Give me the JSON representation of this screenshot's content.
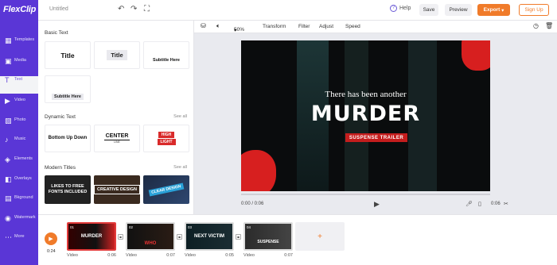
{
  "app": {
    "logo": "FlexClip",
    "doc_title": "Untitled"
  },
  "topbar": {
    "undo_icon": "undo-icon",
    "redo_icon": "redo-icon",
    "fullscreen_icon": "fullscreen-icon",
    "help": "Help",
    "save": "Save",
    "preview": "Preview",
    "export": "Export",
    "signup": "Sign Up"
  },
  "sidebar": {
    "items": [
      {
        "label": "Templates",
        "icon": "templates-icon"
      },
      {
        "label": "Media",
        "icon": "media-icon"
      },
      {
        "label": "Text",
        "icon": "text-icon"
      },
      {
        "label": "Video",
        "icon": "video-icon"
      },
      {
        "label": "Photo",
        "icon": "photo-icon"
      },
      {
        "label": "Music",
        "icon": "music-icon"
      },
      {
        "label": "Elements",
        "icon": "elements-icon"
      },
      {
        "label": "Overlays",
        "icon": "overlays-icon"
      },
      {
        "label": "Bkground",
        "icon": "background-icon"
      },
      {
        "label": "Watermark",
        "icon": "watermark-icon"
      },
      {
        "label": "More",
        "icon": "more-icon"
      }
    ],
    "active": "Text"
  },
  "panel": {
    "basic_text": {
      "heading": "Basic Text",
      "tiles": [
        "Title",
        "Title",
        "Subtitle Here",
        "Subtitle Here"
      ]
    },
    "dynamic_text": {
      "heading": "Dynamic Text",
      "see_all": "See all",
      "tiles": {
        "bottom_up": "Bottom Up Down",
        "center": "CENTER",
        "center_sub": "LINE",
        "high": "HIGH",
        "light": "LIGHT"
      }
    },
    "modern_titles": {
      "heading": "Modern Titles",
      "see_all": "See all",
      "tiles": [
        "LIKES TO FREE FONTS INCLUDED",
        "CREATIVE DESIGN",
        "CLEAR DESIGN"
      ]
    }
  },
  "canvas_toolbar": {
    "zoom": "50%",
    "transform": "Transform",
    "filter": "Filter",
    "adjust": "Adjust",
    "speed": "Speed"
  },
  "video": {
    "line1": "There has been another",
    "line2": "MURDER",
    "tag": "SUSPENSE TRAILER",
    "time_current": "0:00 / 0:06",
    "time_end": "0:06"
  },
  "timeline": {
    "time": "0:24",
    "clips": [
      {
        "num": "01",
        "title": "MURDER",
        "type": "Video",
        "duration": "0:06"
      },
      {
        "num": "02",
        "title": "WHO",
        "type": "Video",
        "duration": "0:07"
      },
      {
        "num": "03",
        "title": "NEXT VICTIM",
        "type": "Video",
        "duration": "0:05"
      },
      {
        "num": "04",
        "title": "SUSPENSE",
        "type": "Video",
        "duration": "0:07"
      }
    ]
  },
  "colors": {
    "brand": "#5a36d6",
    "accent": "#f07b2a",
    "blood": "#d71f1f"
  }
}
